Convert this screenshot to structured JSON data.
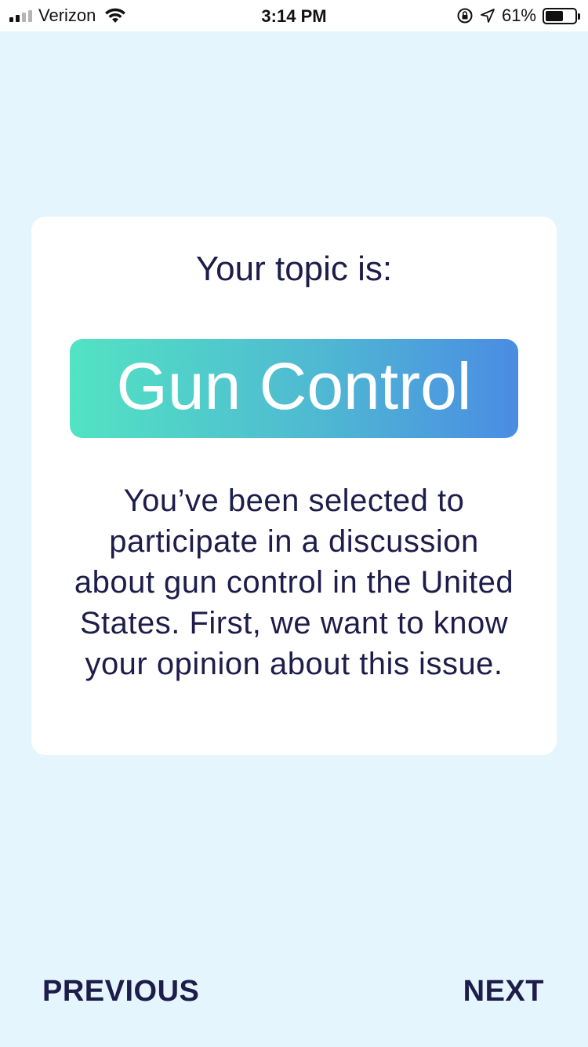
{
  "status_bar": {
    "carrier": "Verizon",
    "time": "3:14 PM",
    "battery_percent": "61%",
    "battery_level": 0.61,
    "icons": [
      "signal-icon",
      "wifi-icon",
      "rotation-lock-icon",
      "location-icon",
      "battery-icon"
    ]
  },
  "card": {
    "heading": "Your topic is:",
    "topic": "Gun Control",
    "description": "You’ve been selected to participate in a discussion about gun control in the United States. First, we want to know your opinion about this issue."
  },
  "nav": {
    "previous_label": "PREVIOUS",
    "next_label": "NEXT"
  },
  "colors": {
    "background": "#e4f5fe",
    "text": "#1e1d4a",
    "gradient_start": "#52e3c3",
    "gradient_end": "#4a8ce3"
  }
}
